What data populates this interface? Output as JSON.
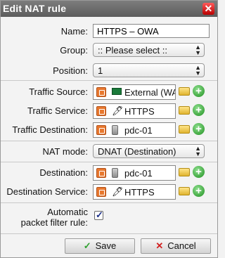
{
  "dialog": {
    "title": "Edit NAT rule",
    "close_icon": "close-icon"
  },
  "fields": {
    "name": {
      "label": "Name:",
      "value": "HTTPS – OWA"
    },
    "group": {
      "label": "Group:",
      "value": ":: Please select ::"
    },
    "position": {
      "label": "Position:",
      "value": "1"
    },
    "traffic_source": {
      "label": "Traffic Source:",
      "value": "External (WA",
      "icon": "network-card-icon"
    },
    "traffic_service": {
      "label": "Traffic Service:",
      "value": "HTTPS",
      "icon": "service-icon"
    },
    "traffic_destination": {
      "label": "Traffic Destination:",
      "value": "pdc-01",
      "icon": "server-icon"
    },
    "nat_mode": {
      "label": "NAT mode:",
      "value": "DNAT (Destination)"
    },
    "destination": {
      "label": "Destination:",
      "value": "pdc-01",
      "icon": "server-icon"
    },
    "destination_service": {
      "label": "Destination Service:",
      "value": "HTTPS",
      "icon": "service-icon"
    },
    "auto_filter": {
      "label_line1": "Automatic",
      "label_line2": "packet filter rule:",
      "checked": true
    }
  },
  "buttons": {
    "save": "Save",
    "cancel": "Cancel"
  },
  "colors": {
    "titlebar": "#6a6a6a",
    "plus": "#1f8f1f",
    "trash": "#e8782e"
  }
}
